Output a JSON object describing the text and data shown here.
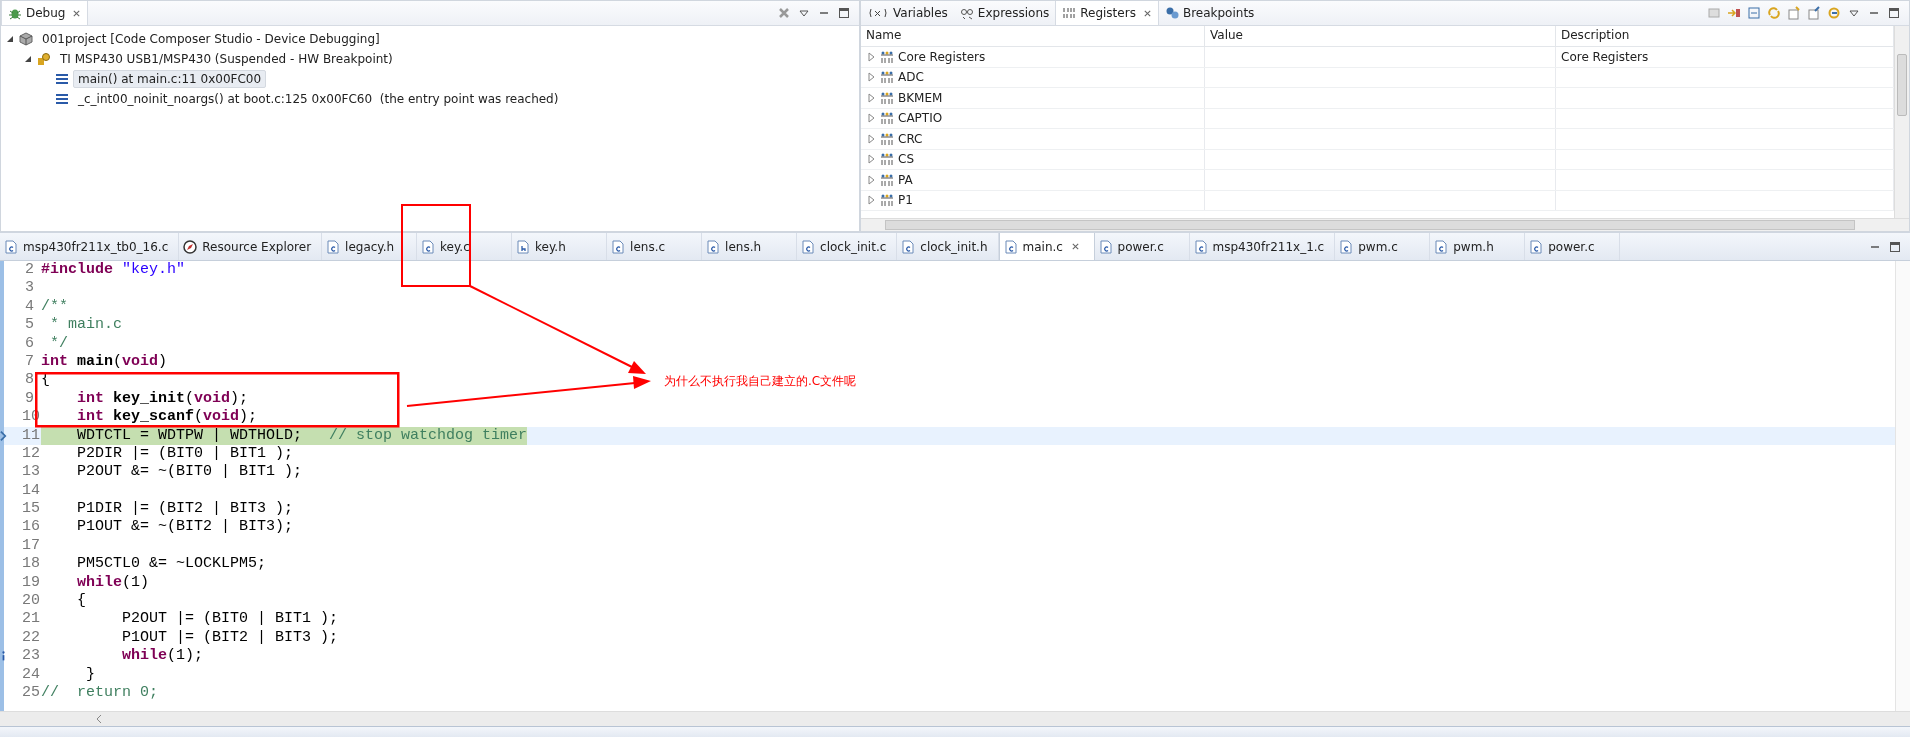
{
  "debug": {
    "title": "Debug",
    "tree": [
      {
        "kind": "project",
        "label": "001project [Code Composer Studio - Device Debugging]",
        "expanded": true,
        "children": [
          {
            "kind": "device",
            "label": "TI MSP430 USB1/MSP430 (Suspended - HW Breakpoint)",
            "expanded": true,
            "children": [
              {
                "kind": "frame",
                "label": "main() at main.c:11 0x00FC00",
                "selected": true
              },
              {
                "kind": "frame",
                "label": "_c_int00_noinit_noargs() at boot.c:125 0x00FC60  (the entry point was reached)",
                "selected": false
              }
            ]
          }
        ]
      }
    ]
  },
  "registers": {
    "tabs": [
      {
        "kind": "variables",
        "label": "Variables",
        "selected": false
      },
      {
        "kind": "expressions",
        "label": "Expressions",
        "selected": false
      },
      {
        "kind": "registers",
        "label": "Registers",
        "selected": true
      },
      {
        "kind": "breakpoints",
        "label": "Breakpoints",
        "selected": false
      }
    ],
    "columns": [
      "Name",
      "Value",
      "Description"
    ],
    "rows": [
      {
        "name": "Core Registers",
        "description": "Core Registers",
        "expanded": false
      },
      {
        "name": "ADC",
        "expanded": false
      },
      {
        "name": "BKMEM",
        "expanded": false
      },
      {
        "name": "CAPTIO",
        "expanded": false
      },
      {
        "name": "CRC",
        "expanded": false
      },
      {
        "name": "CS",
        "expanded": false
      },
      {
        "name": "PA",
        "expanded": false
      },
      {
        "name": "P1",
        "expanded": false
      }
    ]
  },
  "editor_tabs": [
    {
      "kind": "c",
      "label": "msp430fr211x_tb0_16.c",
      "selected": false
    },
    {
      "kind": "explorer",
      "label": "Resource Explorer",
      "selected": false
    },
    {
      "kind": "c",
      "label": "legacy.h",
      "selected": false
    },
    {
      "kind": "c",
      "label": "key.c",
      "selected": false
    },
    {
      "kind": "h",
      "label": "key.h",
      "selected": false
    },
    {
      "kind": "c",
      "label": "lens.c",
      "selected": false
    },
    {
      "kind": "c",
      "label": "lens.h",
      "selected": false
    },
    {
      "kind": "c",
      "label": "clock_init.c",
      "selected": false
    },
    {
      "kind": "c",
      "label": "clock_init.h",
      "selected": false
    },
    {
      "kind": "c",
      "label": "main.c",
      "selected": true
    },
    {
      "kind": "c",
      "label": "power.c",
      "selected": false
    },
    {
      "kind": "c",
      "label": "msp430fr211x_1.c",
      "selected": false
    },
    {
      "kind": "c",
      "label": "pwm.c",
      "selected": false
    },
    {
      "kind": "c",
      "label": "pwm.h",
      "selected": false
    },
    {
      "kind": "c",
      "label": "power.c",
      "selected": false
    }
  ],
  "code": [
    {
      "num": "2",
      "current": false,
      "info": false,
      "tokens": [
        {
          "kind": "kw",
          "text": "#include "
        },
        {
          "kind": "str",
          "text": "\"key.h\""
        }
      ]
    },
    {
      "num": "3",
      "current": false,
      "info": false
    },
    {
      "num": "4",
      "current": false,
      "info": false,
      "tokens": [
        {
          "kind": "comment",
          "text": "/**"
        }
      ]
    },
    {
      "num": "5",
      "current": false,
      "info": false,
      "tokens": [
        {
          "kind": "comment",
          "text": " * main.c"
        }
      ]
    },
    {
      "num": "6",
      "current": false,
      "info": false,
      "tokens": [
        {
          "kind": "comment",
          "text": " */"
        }
      ]
    },
    {
      "num": "7",
      "current": false,
      "info": false,
      "tokens": [
        {
          "kind": "kw",
          "text": "int "
        },
        {
          "kind": "fn",
          "text": "main"
        },
        {
          "kind": "plain",
          "text": "("
        },
        {
          "kind": "kw",
          "text": "void"
        },
        {
          "kind": "plain",
          "text": ")"
        }
      ]
    },
    {
      "num": "8",
      "current": false,
      "info": false,
      "tokens": [
        {
          "kind": "plain",
          "text": "{"
        }
      ]
    },
    {
      "num": "9",
      "current": false,
      "info": false,
      "tokens": [
        {
          "kind": "kw",
          "text": "    int "
        },
        {
          "kind": "fn",
          "text": "key_init"
        },
        {
          "kind": "plain",
          "text": "("
        },
        {
          "kind": "kw",
          "text": "void"
        },
        {
          "kind": "plain",
          "text": ");"
        }
      ]
    },
    {
      "num": "10",
      "current": false,
      "info": false,
      "tokens": [
        {
          "kind": "kw",
          "text": "    int "
        },
        {
          "kind": "fn",
          "text": "key_scanf"
        },
        {
          "kind": "plain",
          "text": "("
        },
        {
          "kind": "kw",
          "text": "void"
        },
        {
          "kind": "plain",
          "text": ");"
        }
      ]
    },
    {
      "num": "11",
      "current": true,
      "info": false,
      "tokens": [
        {
          "kind": "plain",
          "text": "    WDTCTL = WDTPW | WDTHOLD;   "
        },
        {
          "kind": "comment",
          "text": "// stop watchdog timer"
        }
      ]
    },
    {
      "num": "12",
      "current": false,
      "info": false,
      "tokens": [
        {
          "kind": "plain",
          "text": "    P2DIR |= (BIT0 | BIT1 );"
        }
      ]
    },
    {
      "num": "13",
      "current": false,
      "info": false,
      "tokens": [
        {
          "kind": "plain",
          "text": "    P2OUT &= ~(BIT0 | BIT1 );"
        }
      ]
    },
    {
      "num": "14",
      "current": false,
      "info": false
    },
    {
      "num": "15",
      "current": false,
      "info": false,
      "tokens": [
        {
          "kind": "plain",
          "text": "    P1DIR |= (BIT2 | BIT3 );"
        }
      ]
    },
    {
      "num": "16",
      "current": false,
      "info": false,
      "tokens": [
        {
          "kind": "plain",
          "text": "    P1OUT &= ~(BIT2 | BIT3);"
        }
      ]
    },
    {
      "num": "17",
      "current": false,
      "info": false
    },
    {
      "num": "18",
      "current": false,
      "info": false,
      "tokens": [
        {
          "kind": "plain",
          "text": "    PM5CTL0 &= ~LOCKLPM5;"
        }
      ]
    },
    {
      "num": "19",
      "current": false,
      "info": false,
      "tokens": [
        {
          "kind": "kw",
          "text": "    while"
        },
        {
          "kind": "plain",
          "text": "(1)"
        }
      ]
    },
    {
      "num": "20",
      "current": false,
      "info": false,
      "tokens": [
        {
          "kind": "plain",
          "text": "    {"
        }
      ]
    },
    {
      "num": "21",
      "current": false,
      "info": false,
      "tokens": [
        {
          "kind": "plain",
          "text": "         P2OUT |= (BIT0 | BIT1 );"
        }
      ]
    },
    {
      "num": "22",
      "current": false,
      "info": false,
      "tokens": [
        {
          "kind": "plain",
          "text": "         P1OUT |= (BIT2 | BIT3 );"
        }
      ]
    },
    {
      "num": "23",
      "current": false,
      "info": true,
      "tokens": [
        {
          "kind": "kw",
          "text": "         while"
        },
        {
          "kind": "plain",
          "text": "(1);"
        }
      ]
    },
    {
      "num": "24",
      "current": false,
      "info": false,
      "tokens": [
        {
          "kind": "plain",
          "text": "     }"
        }
      ]
    },
    {
      "num": "25",
      "current": false,
      "info": false,
      "tokens": [
        {
          "kind": "comment",
          "text": "//  return 0;"
        }
      ]
    }
  ],
  "annotation": {
    "note": "为什么不执行我自己建立的.C文件呢"
  }
}
